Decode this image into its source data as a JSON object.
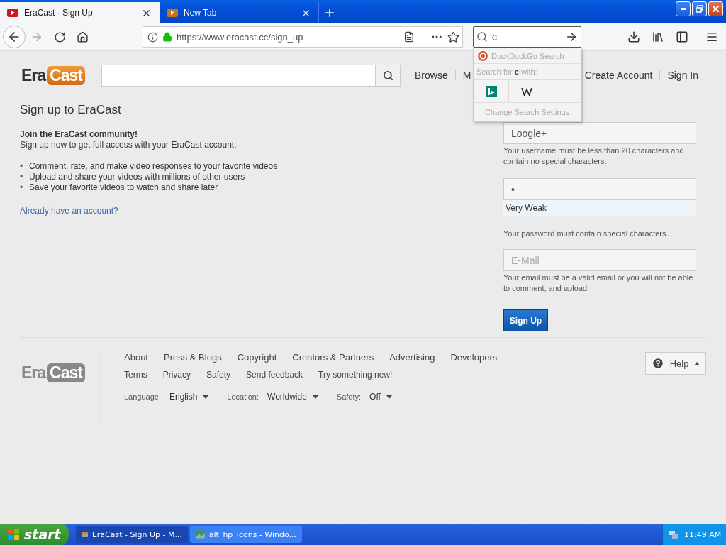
{
  "browser": {
    "tabs": [
      {
        "title": "EraCast - Sign Up",
        "selected": true
      },
      {
        "title": "New Tab",
        "selected": false
      }
    ],
    "toolbar": {
      "back_enabled": true,
      "forward_enabled": false
    },
    "address_bar": {
      "url": "https://www.eracast.cc/sign_up"
    },
    "search_bar": {
      "value": "c"
    },
    "search_popup": {
      "engine": "DuckDuckGo Search",
      "prompt": "Search for **c** with:",
      "footer": "Change Search Settings"
    }
  },
  "page": {
    "logo": {
      "part_1": "Era",
      "part_2": "Cast"
    },
    "nav": [
      "Browse",
      "M"
    ],
    "account_links": [
      "Create Account",
      "Sign In"
    ],
    "title": "Sign up to EraCast",
    "intro_title": "Join the EraCast community!",
    "intro_text": "Sign up now to get full access with your EraCast account:",
    "benefits": [
      {
        "marker": "•",
        "text": "Comment, rate, and make video responses to your favorite videos"
      },
      {
        "marker": "•",
        "text": "Upload and share your videos with millions of other users"
      },
      {
        "marker": "•",
        "text": "Save your favorite videos to watch and share later"
      }
    ],
    "login_link": "Already have an account?",
    "form": {
      "username": {
        "value": "Loogle+",
        "hint": "Your username must be less than 20 characters and contain no special characters."
      },
      "password": {
        "value": "•",
        "strength": "Very Weak",
        "hint": "Your password must contain special characters."
      },
      "email": {
        "placeholder": "E-Mail",
        "hint": "Your email must be a valid email or you will not be able to comment, and upload!"
      },
      "submit": "Sign Up"
    },
    "footer": {
      "logo": {
        "part_1": "Era",
        "part_2": "Cast"
      },
      "links_1": [
        "About",
        "Press & Blogs",
        "Copyright",
        "Creators & Partners",
        "Advertising",
        "Developers"
      ],
      "links_2": [
        "Terms",
        "Privacy",
        "Safety",
        "Send feedback",
        "Try something new!"
      ],
      "selects": [
        {
          "label": "Language:",
          "value": "English"
        },
        {
          "label": "Location:",
          "value": "Worldwide"
        },
        {
          "label": "Safety:",
          "value": "Off"
        }
      ],
      "help": "Help"
    }
  },
  "taskbar": {
    "start": "start",
    "tasks": [
      {
        "label": "EraCast - Sign Up - M...",
        "selected": true
      },
      {
        "label": "alt_hp_icons - Windo...",
        "selected": false
      }
    ],
    "clock": "11:49 AM"
  }
}
